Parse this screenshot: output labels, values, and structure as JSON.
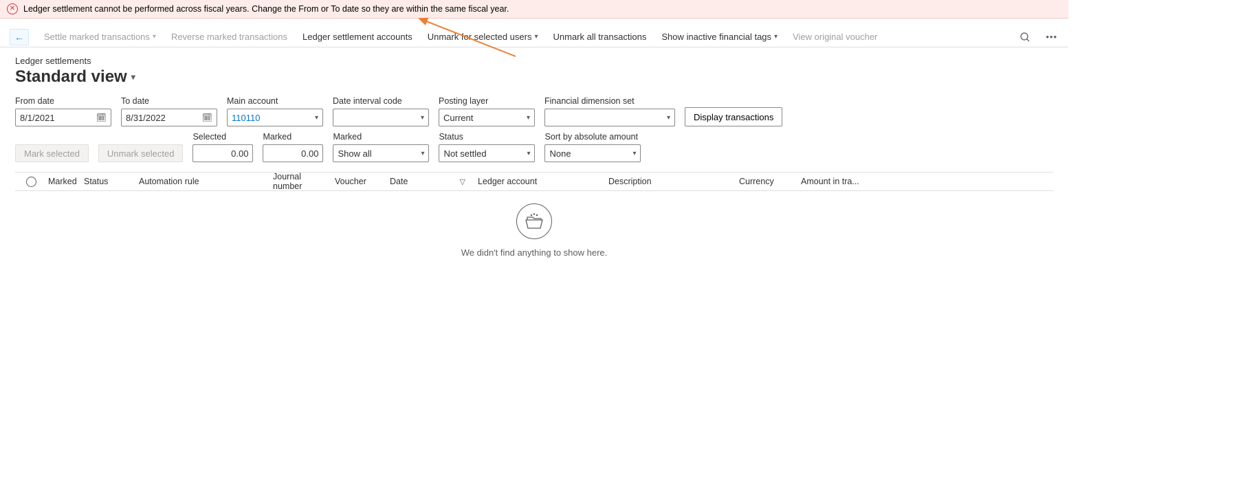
{
  "banner": {
    "message": "Ledger settlement cannot be performed across fiscal years. Change the From or To date so they are within the same fiscal year."
  },
  "actions": {
    "settle_marked": "Settle marked transactions",
    "reverse_marked": "Reverse marked transactions",
    "ledger_accounts": "Ledger settlement accounts",
    "unmark_users": "Unmark for selected users",
    "unmark_all": "Unmark all transactions",
    "show_inactive": "Show inactive financial tags",
    "view_voucher": "View original voucher"
  },
  "header": {
    "breadcrumb": "Ledger settlements",
    "view_name": "Standard view"
  },
  "filters1": {
    "from_date": {
      "label": "From date",
      "value": "8/1/2021"
    },
    "to_date": {
      "label": "To date",
      "value": "8/31/2022"
    },
    "main_account": {
      "label": "Main account",
      "value": "110110"
    },
    "date_interval": {
      "label": "Date interval code",
      "value": ""
    },
    "posting_layer": {
      "label": "Posting layer",
      "value": "Current"
    },
    "fin_dim_set": {
      "label": "Financial dimension set",
      "value": ""
    },
    "display_btn": "Display transactions"
  },
  "filters2": {
    "mark_selected": "Mark selected",
    "unmark_selected": "Unmark selected",
    "selected": {
      "label": "Selected",
      "value": "0.00"
    },
    "marked": {
      "label": "Marked",
      "value": "0.00"
    },
    "marked_filter": {
      "label": "Marked",
      "value": "Show all"
    },
    "status": {
      "label": "Status",
      "value": "Not settled"
    },
    "sort_abs": {
      "label": "Sort by absolute amount",
      "value": "None"
    }
  },
  "columns": {
    "marked": "Marked",
    "status": "Status",
    "automation_rule": "Automation rule",
    "journal_number": "Journal number",
    "voucher": "Voucher",
    "date": "Date",
    "ledger_account": "Ledger account",
    "description": "Description",
    "currency": "Currency",
    "amount": "Amount in tra..."
  },
  "empty_text": "We didn't find anything to show here.",
  "colors": {
    "banner_bg": "#fdecea",
    "error": "#d13438",
    "link_blue": "#0078d4",
    "arrow": "#ed7d31"
  }
}
